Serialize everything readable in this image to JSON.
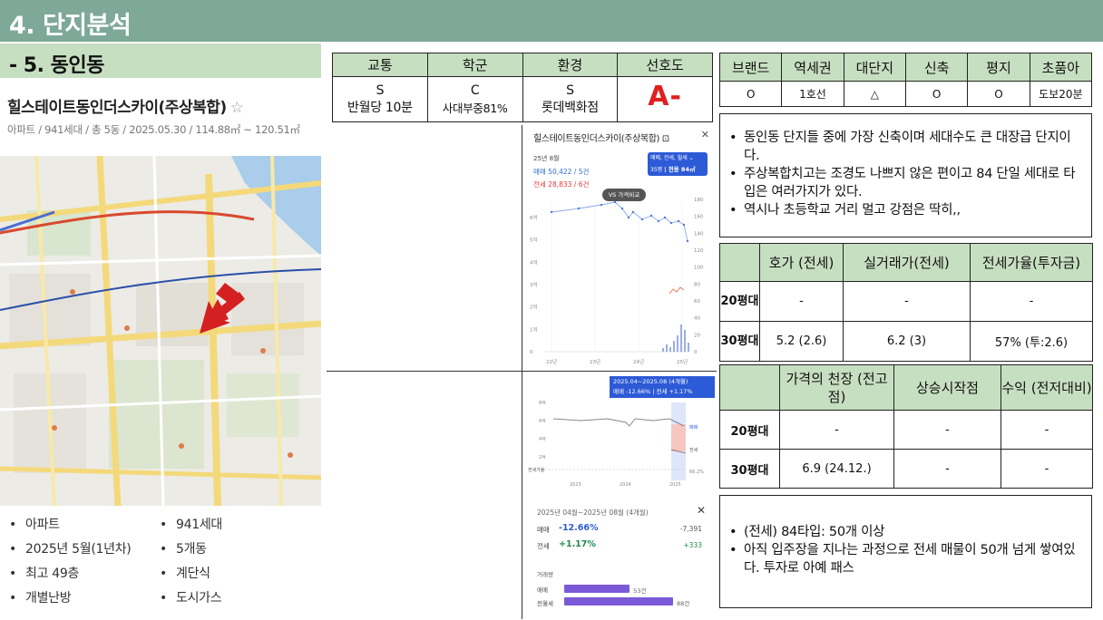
{
  "header": {
    "title": "4. 단지분석"
  },
  "section": {
    "title": "- 5. 동인동"
  },
  "complex": {
    "name": "힐스테이트동인더스카이(주상복합)",
    "meta": "아파트 / 941세대 / 총 5동 / 2025.05.30 / 114.88㎡ ~ 120.51㎡",
    "features_left": [
      "아파트",
      "2025년 5월(1년차)",
      "최고 49층",
      "개별난방"
    ],
    "features_right": [
      "941세대",
      "5개동",
      "계단식",
      "도시가스"
    ]
  },
  "grades": {
    "headers": [
      "교통",
      "학군",
      "환경",
      "선호도"
    ],
    "values": [
      {
        "grade": "S",
        "detail": "반월당 10분"
      },
      {
        "grade": "C",
        "detail": "사대부중81%"
      },
      {
        "grade": "S",
        "detail": "롯데백화점"
      }
    ],
    "preference": "A-"
  },
  "tags": {
    "headers": [
      "브랜드",
      "역세권",
      "대단지",
      "신축",
      "평지",
      "초품아"
    ],
    "values": [
      "O",
      "1호선",
      "△",
      "O",
      "O",
      "도보20분"
    ]
  },
  "notes_top": [
    "동인동 단지들 중에 가장 신축이며 세대수도 큰 대장급 단지이다.",
    "주상복합치고는 조경도 나쁘지 않은 편이고 84 단일 세대로 타입은 여러가지가 있다.",
    "역시나 초등학교 거리 멀고 강점은 딱히,,"
  ],
  "price_table": {
    "headers": [
      "",
      "호가 (전세)",
      "실거래가(전세)",
      "전세가율(투자금)"
    ],
    "rows": [
      {
        "label": "20평대",
        "ask": "-",
        "actual": "-",
        "ratio": "-"
      },
      {
        "label": "30평대",
        "ask": "5.2 (2.6)",
        "actual": "6.2 (3)",
        "ratio": "57% (투:2.6)"
      }
    ]
  },
  "peak_table": {
    "headers": [
      "",
      "가격의 천장 (전고점)",
      "상승시작점",
      "수익 (전저대비)"
    ],
    "rows": [
      {
        "label": "20평대",
        "peak": "-",
        "start": "-",
        "profit": "-"
      },
      {
        "label": "30평대",
        "peak": "6.9 (24.12.)",
        "start": "-",
        "profit": "-"
      }
    ]
  },
  "notes_bottom": [
    "(전세) 84타입: 50개 이상",
    "아직 입주장을 지나는 과정으로 전세 매물이 50개 넘게 쌓여있다. 투자로 아예 패스"
  ],
  "shot1": {
    "title": "힐스테이트동인더스카이(주상복합)",
    "date": "25년 8월",
    "sale": "매매 50,422 / 5건",
    "jeonse": "전세 28,833 / 6건",
    "filter_line1": "매매, 전세, 월세 ⌄",
    "filter_line2": "35평 ",
    "filter_area": "| 전용 84㎡",
    "vs_label": "VS 가격비교",
    "y_ticks_left": [
      "6억",
      "5억",
      "4억",
      "3억",
      "2억",
      "1억",
      "0"
    ],
    "y_ticks_right": [
      "180",
      "160",
      "140",
      "120",
      "100",
      "80",
      "60",
      "40",
      "20",
      "0"
    ],
    "x_ticks": [
      "22년",
      "23년",
      "24년",
      "25년"
    ]
  },
  "shot2": {
    "banner_line1": "2025.04~2025.08 (4개월)",
    "banner_line2": "매매 -12.66%  |  전세 +1.17%",
    "y_ticks": [
      "8억",
      "6억",
      "4억",
      "2억"
    ],
    "x_ticks": [
      "2023",
      "2024",
      "2025"
    ],
    "legend_sale": "매매",
    "legend_jeonse": "전세",
    "left_label": "전세가율",
    "right_pct": "66.2%"
  },
  "shot3": {
    "period": "2025년 04월~2025년 08월 (4개월)",
    "sale_label": "매매",
    "sale_pct": "-12.66%",
    "sale_diff": "-7,391",
    "jeonse_label": "전세",
    "jeonse_pct": "+1.17%",
    "jeonse_diff": "+333",
    "volume_title": "거래량",
    "vol_sale_label": "매매",
    "vol_sale_count": "53건",
    "vol_sale_value": 53,
    "vol_jeonse_label": "전월세",
    "vol_jeonse_count": "88건",
    "vol_jeonse_value": 88
  },
  "colors": {
    "header_bar": "#7ea898",
    "sub_bar": "#c7dfc1",
    "grade_accent": "#e02020",
    "chart_blue": "#2d5ad6"
  }
}
